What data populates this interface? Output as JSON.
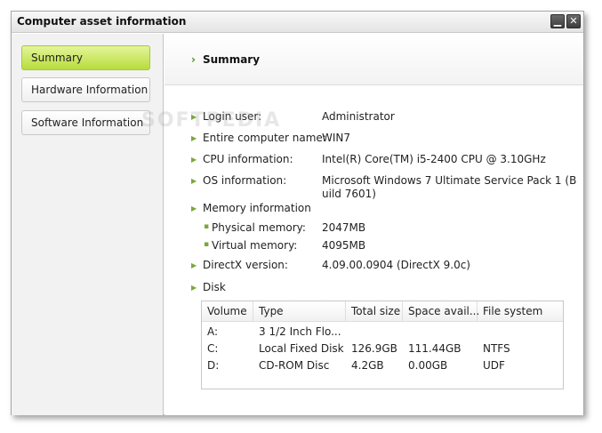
{
  "window": {
    "title": "Computer asset information",
    "minimize_glyph": "▁",
    "close_glyph": "✕"
  },
  "sidebar": {
    "items": [
      {
        "label": "Summary",
        "active": true
      },
      {
        "label": "Hardware Information",
        "active": false
      },
      {
        "label": "Software Information",
        "active": false
      }
    ]
  },
  "summary": {
    "title": "Summary",
    "fields": {
      "login_user": {
        "label": "Login user:",
        "value": "Administrator"
      },
      "computer_name": {
        "label": "Entire computer name:",
        "value": "WIN7"
      },
      "cpu": {
        "label": "CPU information:",
        "value": "Intel(R) Core(TM) i5-2400 CPU @ 3.10GHz"
      },
      "os": {
        "label": "OS information:",
        "value_line1": "Microsoft Windows 7 Ultimate  Service Pack 1 (B",
        "value_line2": "uild 7601)"
      },
      "memory": {
        "label": "Memory information"
      },
      "physical_memory": {
        "label": "Physical memory:",
        "value": "2047MB"
      },
      "virtual_memory": {
        "label": "Virtual memory:",
        "value": "4095MB"
      },
      "directx": {
        "label": "DirectX version:",
        "value": "4.09.00.0904 (DirectX 9.0c)"
      },
      "disk": {
        "label": "Disk"
      }
    },
    "disk_table": {
      "columns": [
        "Volume",
        "Type",
        "Total size",
        "Space avail...",
        "File system"
      ],
      "rows": [
        [
          "A:",
          "3 1/2 Inch Flo...",
          "",
          "",
          ""
        ],
        [
          "C:",
          "Local Fixed Disk",
          "126.9GB",
          "111.44GB",
          "NTFS"
        ],
        [
          "D:",
          "CD-ROM Disc",
          "4.2GB",
          "0.00GB",
          "UDF"
        ]
      ]
    }
  },
  "watermark": "SOFTPEDIA",
  "colors": {
    "active_nav": "#c8e65a",
    "arrow": "#7aa83a",
    "title_button": "#4a4a4a"
  }
}
